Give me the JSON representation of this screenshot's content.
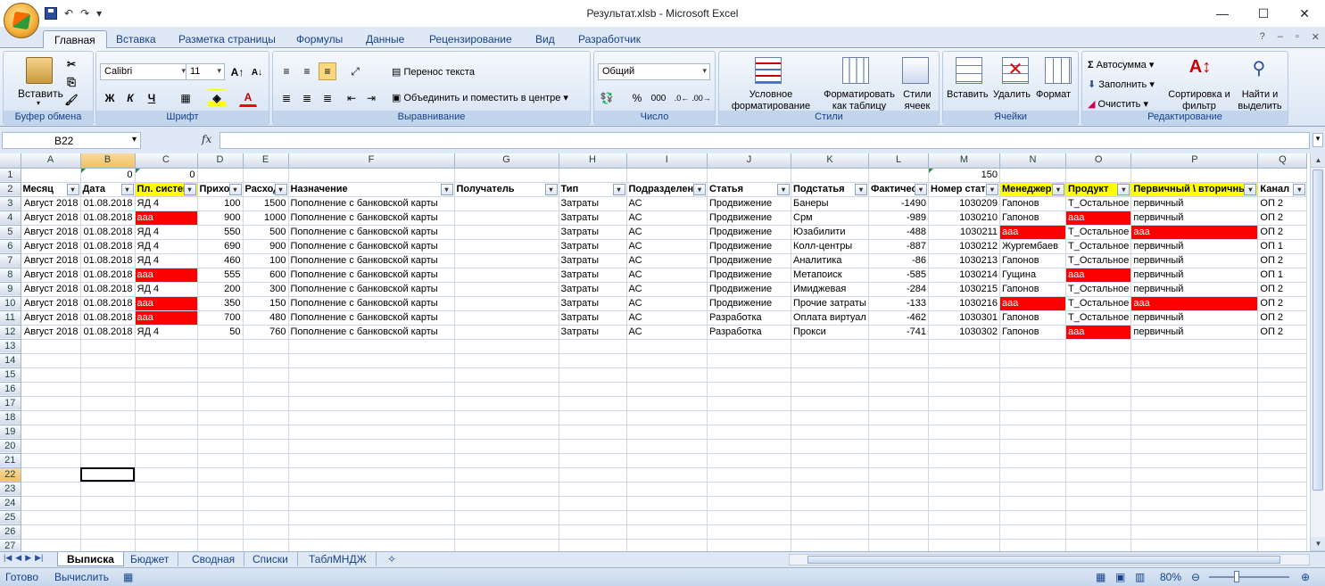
{
  "window": {
    "title": "Результат.xlsb - Microsoft Excel",
    "minimize": "—",
    "maximize": "☐",
    "close": "✕"
  },
  "qat": {
    "undo": "↶",
    "redo": "↷",
    "customize": "▾"
  },
  "ribbon_tabs": [
    "Главная",
    "Вставка",
    "Разметка страницы",
    "Формулы",
    "Данные",
    "Рецензирование",
    "Вид",
    "Разработчик"
  ],
  "ribbon": {
    "clipboard": {
      "name": "Буфер обмена",
      "paste": "Вставить"
    },
    "font": {
      "name": "Шрифт",
      "family": "Calibri",
      "size": "11",
      "bold": "Ж",
      "italic": "К",
      "underline": "Ч"
    },
    "alignment": {
      "name": "Выравнивание",
      "wrap": "Перенос текста",
      "merge": "Объединить и поместить в центре"
    },
    "number": {
      "name": "Число",
      "format": "Общий",
      "percent": "%",
      "thousands": "000"
    },
    "styles": {
      "name": "Стили",
      "conditional": "Условное форматирование",
      "as_table": "Форматировать как таблицу",
      "cell_styles": "Стили ячеек"
    },
    "cells": {
      "name": "Ячейки",
      "insert": "Вставить",
      "delete": "Удалить",
      "format": "Формат"
    },
    "editing": {
      "name": "Редактирование",
      "autosum": "Автосумма",
      "fill": "Заполнить",
      "clear": "Очистить",
      "sort": "Сортировка и фильтр",
      "find": "Найти и выделить"
    }
  },
  "formula_bar": {
    "name_box": "B22",
    "fx": "fx",
    "formula": ""
  },
  "columns": [
    "A",
    "B",
    "C",
    "D",
    "E",
    "F",
    "G",
    "H",
    "I",
    "J",
    "K",
    "L",
    "M",
    "N",
    "O",
    "P",
    "Q"
  ],
  "row1": {
    "B": "0",
    "C": "0",
    "M": "150"
  },
  "headers": [
    "Месяц",
    "Дата",
    "Пл. систем",
    "Приход",
    "Расход",
    "Назначение",
    "Получатель",
    "Тип",
    "Подразделение",
    "Статья",
    "Подстатья",
    "Фактическ",
    "Номер стат",
    "Менеджер",
    "Продукт",
    "Первичный \\ вторичный",
    "Канал"
  ],
  "rows": [
    [
      "Август 2018",
      "01.08.2018",
      "ЯД 4",
      "100",
      "1500",
      "Пополнение с банковской карты",
      "",
      "Затраты",
      "АС",
      "Продвижение",
      "Банеры",
      "-1490",
      "1030209",
      "Гапонов",
      "Т_Остальное",
      "первичный",
      "ОП 2"
    ],
    [
      "Август 2018",
      "01.08.2018",
      "ааа",
      "900",
      "1000",
      "Пополнение с банковской карты",
      "",
      "Затраты",
      "АС",
      "Продвижение",
      "Срм",
      "-989",
      "1030210",
      "Гапонов",
      "ааа",
      "первичный",
      "ОП 2"
    ],
    [
      "Август 2018",
      "01.08.2018",
      "ЯД 4",
      "550",
      "500",
      "Пополнение с банковской карты",
      "",
      "Затраты",
      "АС",
      "Продвижение",
      "Юзабилити",
      "-488",
      "1030211",
      "ааа",
      "Т_Остальное",
      "ааа",
      "ОП 2"
    ],
    [
      "Август 2018",
      "01.08.2018",
      "ЯД 4",
      "690",
      "900",
      "Пополнение с банковской карты",
      "",
      "Затраты",
      "АС",
      "Продвижение",
      "Колл-центры",
      "-887",
      "1030212",
      "Жургембаев",
      "Т_Остальное",
      "первичный",
      "ОП 1"
    ],
    [
      "Август 2018",
      "01.08.2018",
      "ЯД 4",
      "460",
      "100",
      "Пополнение с банковской карты",
      "",
      "Затраты",
      "АС",
      "Продвижение",
      "Аналитика",
      "-86",
      "1030213",
      "Гапонов",
      "Т_Остальное",
      "первичный",
      "ОП 2"
    ],
    [
      "Август 2018",
      "01.08.2018",
      "ааа",
      "555",
      "600",
      "Пополнение с банковской карты",
      "",
      "Затраты",
      "АС",
      "Продвижение",
      "Метапоиск",
      "-585",
      "1030214",
      "Гущина",
      "ааа",
      "первичный",
      "ОП 1"
    ],
    [
      "Август 2018",
      "01.08.2018",
      "ЯД 4",
      "200",
      "300",
      "Пополнение с банковской карты",
      "",
      "Затраты",
      "АС",
      "Продвижение",
      "Имиджевая",
      "-284",
      "1030215",
      "Гапонов",
      "Т_Остальное",
      "первичный",
      "ОП 2"
    ],
    [
      "Август 2018",
      "01.08.2018",
      "ааа",
      "350",
      "150",
      "Пополнение с банковской карты",
      "",
      "Затраты",
      "АС",
      "Продвижение",
      "Прочие затраты",
      "-133",
      "1030216",
      "ааа",
      "Т_Остальное",
      "ааа",
      "ОП 2"
    ],
    [
      "Август 2018",
      "01.08.2018",
      "ааа",
      "700",
      "480",
      "Пополнение с банковской карты",
      "",
      "Затраты",
      "АС",
      "Разработка",
      "Оплата виртуал",
      "-462",
      "1030301",
      "Гапонов",
      "Т_Остальное",
      "первичный",
      "ОП 2"
    ],
    [
      "Август 2018",
      "01.08.2018",
      "ЯД 4",
      "50",
      "760",
      "Пополнение с банковской карты",
      "",
      "Затраты",
      "АС",
      "Разработка",
      "Прокси",
      "-741",
      "1030302",
      "Гапонов",
      "ааа",
      "первичный",
      "ОП 2"
    ]
  ],
  "empty_rows": [
    13,
    14,
    15,
    16,
    17,
    18,
    19,
    20,
    21,
    22,
    23,
    24,
    25,
    26,
    27
  ],
  "sheet_tabs": [
    "Выписка",
    "Бюджет",
    "Сводная",
    "Списки",
    "ТаблМНДЖ"
  ],
  "status": {
    "ready": "Готово",
    "calc": "Вычислить",
    "zoom": "80%"
  },
  "colors": {
    "red": "#ff0000",
    "yellow": "#ffff00",
    "accent": "#15428b"
  }
}
